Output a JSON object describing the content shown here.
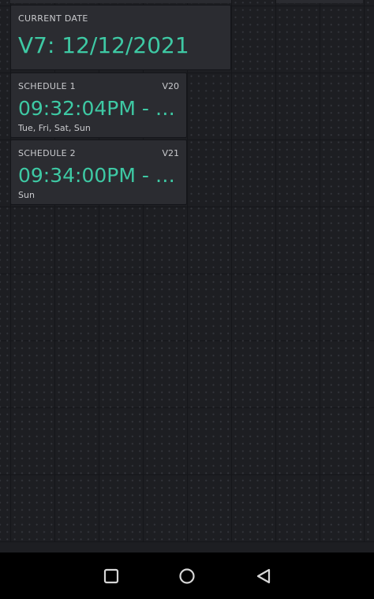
{
  "current_date": {
    "label": "CURRENT DATE",
    "value": "V7: 12/12/2021"
  },
  "schedules": [
    {
      "label": "SCHEDULE 1",
      "pin": "V20",
      "time": "09:32:04PM - 0...",
      "days": "Tue, Fri, Sat, Sun"
    },
    {
      "label": "SCHEDULE 2",
      "pin": "V21",
      "time": "09:34:00PM - 0...",
      "days": "Sun"
    }
  ],
  "navigation": {
    "buttons": [
      {
        "name": "recents",
        "icon": "square-icon"
      },
      {
        "name": "home",
        "icon": "circle-icon"
      },
      {
        "name": "back",
        "icon": "triangle-back-icon"
      }
    ]
  },
  "colors": {
    "accent": "#3ec9a4",
    "widget_bg": "#2b2c31",
    "canvas_bg": "#1d1e22"
  }
}
